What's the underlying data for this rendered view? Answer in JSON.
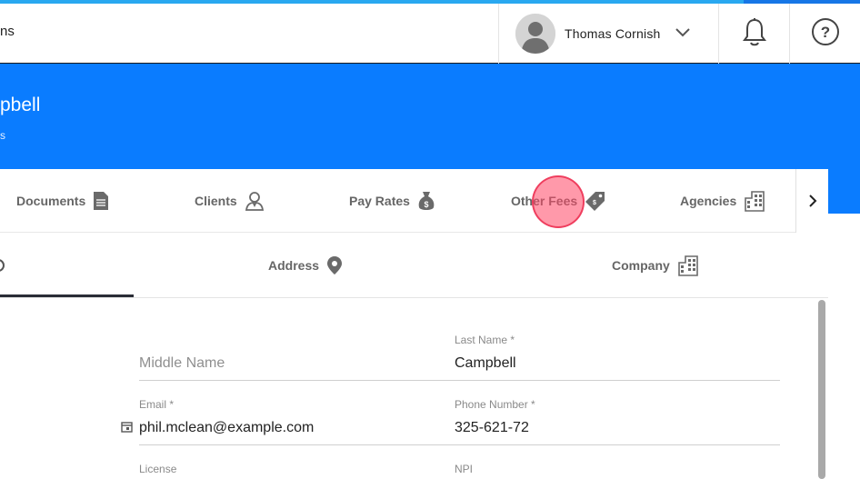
{
  "topbar": {
    "crumb_text": "ns",
    "user_name": "Thomas Cornish"
  },
  "hero": {
    "title": "pbell",
    "subtitle": "s"
  },
  "tabs": [
    {
      "label": "Documents",
      "icon": "document-icon"
    },
    {
      "label": "Clients",
      "icon": "client-icon"
    },
    {
      "label": "Pay Rates",
      "icon": "money-bag-icon"
    },
    {
      "label": "Other Fees",
      "icon": "price-tag-icon"
    },
    {
      "label": "Agencies",
      "icon": "building-icon"
    }
  ],
  "subtabs": [
    {
      "label": "Address",
      "icon": "location-pin-icon"
    },
    {
      "label": "Company",
      "icon": "building-icon"
    }
  ],
  "form": {
    "middle_name": {
      "label": "",
      "placeholder": "Middle Name"
    },
    "last_name": {
      "label": "Last Name *",
      "value": "Campbell"
    },
    "email": {
      "label": "Email *",
      "value": "phil.mclean@example.com"
    },
    "phone": {
      "label": "Phone Number *",
      "value": "325-621-72"
    },
    "license": {
      "label": "License"
    },
    "npi": {
      "label": "NPI"
    }
  },
  "colors": {
    "header_blue": "#0a7cff",
    "accent_top": "#29a8f0",
    "click_marker": "#ff4664"
  }
}
